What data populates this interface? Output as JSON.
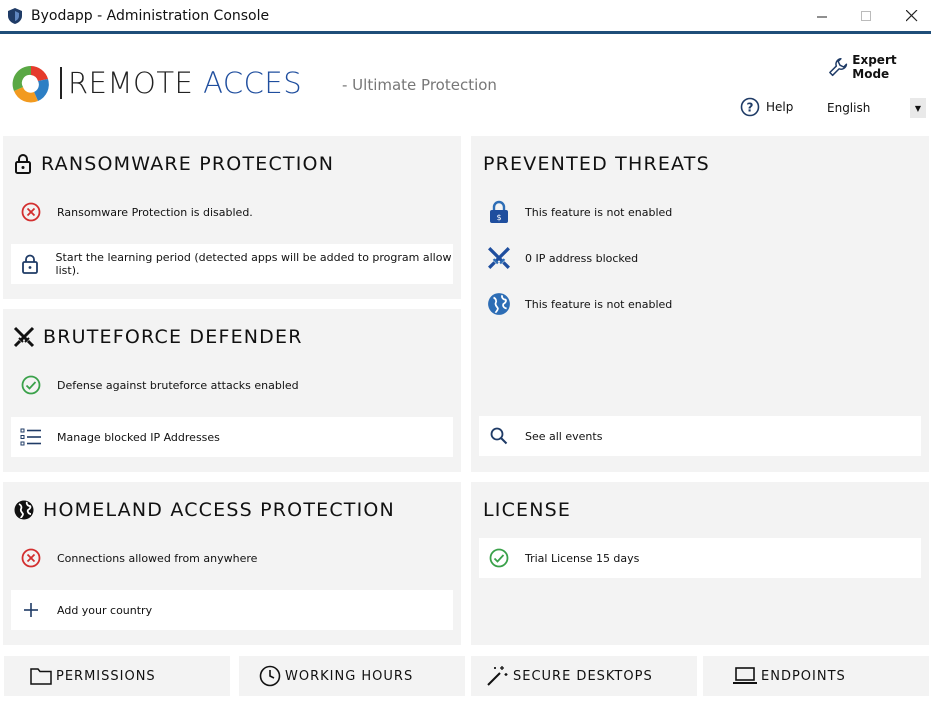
{
  "window": {
    "title": "Byodapp - Administration Console"
  },
  "header": {
    "logo_word1": "REMOTE",
    "logo_word2": "ACCES",
    "tagline": "- Ultimate Protection",
    "expert_mode": "Expert Mode",
    "help": "Help",
    "language": "English"
  },
  "ransomware": {
    "title": "Ransomware Protection",
    "status": "Ransomware Protection is disabled.",
    "action": "Start the learning period (detected apps will be added to program allow list)."
  },
  "bruteforce": {
    "title": "Bruteforce Defender",
    "status": "Defense against bruteforce attacks enabled",
    "action": "Manage blocked IP Addresses"
  },
  "homeland": {
    "title": "Homeland Access Protection",
    "status": "Connections allowed from anywhere",
    "action": "Add your country"
  },
  "threats": {
    "title": "Prevented Threats",
    "items": [
      "This feature is not enabled",
      "0 IP address blocked",
      "This feature is not enabled"
    ],
    "action": "See all events"
  },
  "license": {
    "title": "License",
    "status": "Trial License 15 days"
  },
  "bottom_buttons": [
    "Permissions",
    "Working Hours",
    "Secure Desktops",
    "Endpoints"
  ],
  "colors": {
    "accent": "#1f4e79",
    "error": "#d32f2f",
    "success": "#3aa14a",
    "panel": "#f3f3f3"
  }
}
